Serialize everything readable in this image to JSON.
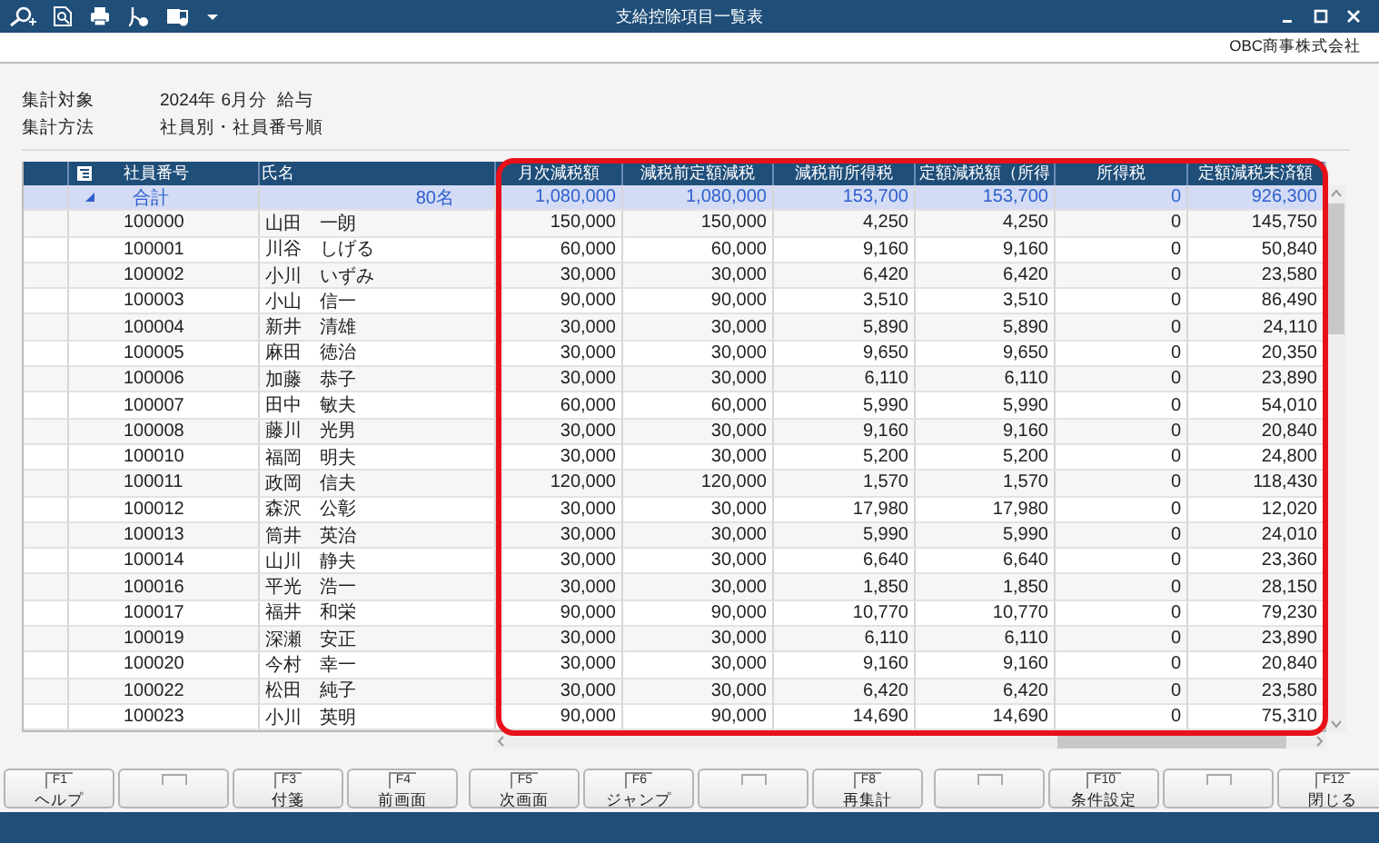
{
  "window": {
    "title": "支給控除項目一覧表"
  },
  "company": "OBC商事株式会社",
  "info": [
    {
      "label": "集計対象",
      "value": "2024年 6月分  給与"
    },
    {
      "label": "集計方法",
      "value": "社員別・社員番号順"
    }
  ],
  "table": {
    "highlighted": true,
    "columns": [
      "社員番号",
      "氏名",
      "月次減税額",
      "減税前定額減税",
      "減税前所得税",
      "定額減税額（所得",
      "所得税",
      "定額減税未済額"
    ],
    "total": {
      "label": "合計",
      "count": "80名",
      "expanded": true,
      "values": [
        "1,080,000",
        "1,080,000",
        "153,700",
        "153,700",
        "0",
        "926,300"
      ]
    },
    "rows": [
      {
        "cells": [
          "100000",
          "山田　一朗",
          "150,000",
          "150,000",
          "4,250",
          "4,250",
          "0",
          "145,750"
        ]
      },
      {
        "cells": [
          "100001",
          "川谷　しげる",
          "60,000",
          "60,000",
          "9,160",
          "9,160",
          "0",
          "50,840"
        ]
      },
      {
        "cells": [
          "100002",
          "小川　いずみ",
          "30,000",
          "30,000",
          "6,420",
          "6,420",
          "0",
          "23,580"
        ]
      },
      {
        "cells": [
          "100003",
          "小山　信一",
          "90,000",
          "90,000",
          "3,510",
          "3,510",
          "0",
          "86,490"
        ]
      },
      {
        "cells": [
          "100004",
          "新井　清雄",
          "30,000",
          "30,000",
          "5,890",
          "5,890",
          "0",
          "24,110"
        ]
      },
      {
        "cells": [
          "100005",
          "麻田　徳治",
          "30,000",
          "30,000",
          "9,650",
          "9,650",
          "0",
          "20,350"
        ]
      },
      {
        "cells": [
          "100006",
          "加藤　恭子",
          "30,000",
          "30,000",
          "6,110",
          "6,110",
          "0",
          "23,890"
        ]
      },
      {
        "cells": [
          "100007",
          "田中　敏夫",
          "60,000",
          "60,000",
          "5,990",
          "5,990",
          "0",
          "54,010"
        ]
      },
      {
        "cells": [
          "100008",
          "藤川　光男",
          "30,000",
          "30,000",
          "9,160",
          "9,160",
          "0",
          "20,840"
        ]
      },
      {
        "cells": [
          "100010",
          "福岡　明夫",
          "30,000",
          "30,000",
          "5,200",
          "5,200",
          "0",
          "24,800"
        ]
      },
      {
        "cells": [
          "100011",
          "政岡　信夫",
          "120,000",
          "120,000",
          "1,570",
          "1,570",
          "0",
          "118,430"
        ]
      },
      {
        "cells": [
          "100012",
          "森沢　公彰",
          "30,000",
          "30,000",
          "17,980",
          "17,980",
          "0",
          "12,020"
        ]
      },
      {
        "cells": [
          "100013",
          "筒井　英治",
          "30,000",
          "30,000",
          "5,990",
          "5,990",
          "0",
          "24,010"
        ]
      },
      {
        "cells": [
          "100014",
          "山川　静夫",
          "30,000",
          "30,000",
          "6,640",
          "6,640",
          "0",
          "23,360"
        ]
      },
      {
        "cells": [
          "100016",
          "平光　浩一",
          "30,000",
          "30,000",
          "1,850",
          "1,850",
          "0",
          "28,150"
        ]
      },
      {
        "cells": [
          "100017",
          "福井　和栄",
          "90,000",
          "90,000",
          "10,770",
          "10,770",
          "0",
          "79,230"
        ]
      },
      {
        "cells": [
          "100019",
          "深瀬　安正",
          "30,000",
          "30,000",
          "6,110",
          "6,110",
          "0",
          "23,890"
        ]
      },
      {
        "cells": [
          "100020",
          "今村　幸一",
          "30,000",
          "30,000",
          "9,160",
          "9,160",
          "0",
          "20,840"
        ]
      },
      {
        "cells": [
          "100022",
          "松田　純子",
          "30,000",
          "30,000",
          "6,420",
          "6,420",
          "0",
          "23,580"
        ]
      },
      {
        "cells": [
          "100023",
          "小川　英明",
          "90,000",
          "90,000",
          "14,690",
          "14,690",
          "0",
          "75,310"
        ]
      }
    ]
  },
  "function_keys": [
    {
      "kind": "assigned",
      "key": "F1",
      "label": "ヘルプ"
    },
    {
      "kind": "empty"
    },
    {
      "kind": "assigned",
      "key": "F3",
      "label": "付箋"
    },
    {
      "kind": "assigned",
      "key": "F4",
      "label": "前画面"
    },
    {
      "kind": "assigned",
      "key": "F5",
      "label": "次画面"
    },
    {
      "kind": "assigned",
      "key": "F6",
      "label": "ジャンプ"
    },
    {
      "kind": "empty"
    },
    {
      "kind": "assigned",
      "key": "F8",
      "label": "再集計"
    },
    {
      "kind": "empty"
    },
    {
      "kind": "assigned",
      "key": "F10",
      "label": "条件設定"
    },
    {
      "kind": "empty"
    },
    {
      "kind": "assigned",
      "key": "F12",
      "label": "閉じる"
    }
  ]
}
